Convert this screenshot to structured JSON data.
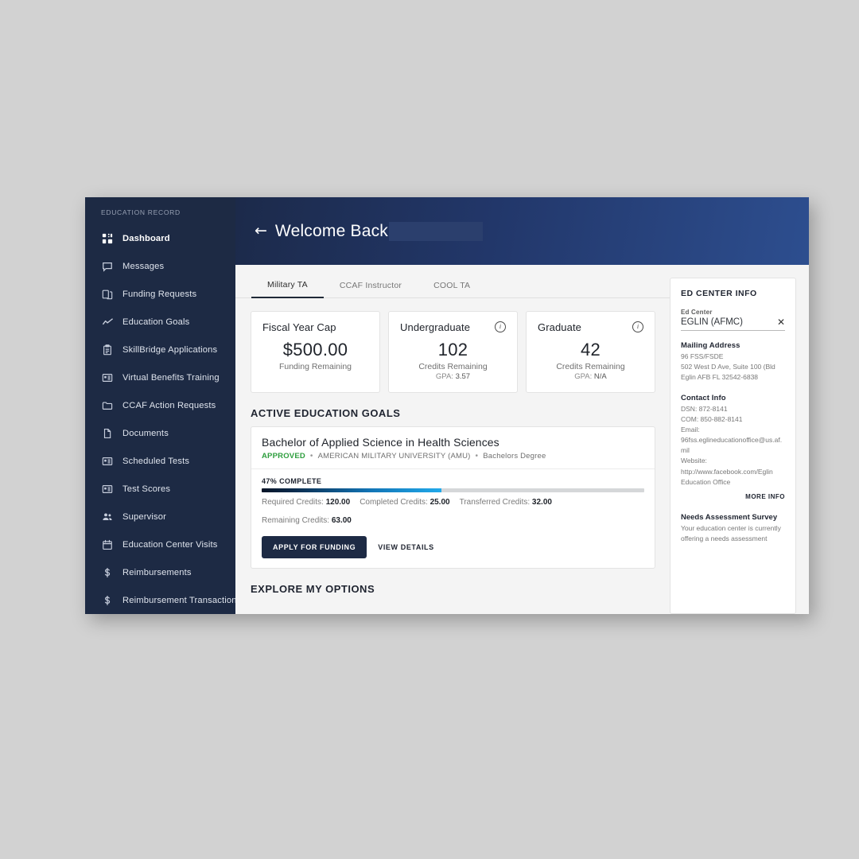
{
  "sidebar": {
    "title": "EDUCATION RECORD",
    "items": [
      {
        "label": "Dashboard",
        "icon": "grid-icon",
        "active": true
      },
      {
        "label": "Messages",
        "icon": "chat-bubble-icon",
        "active": false
      },
      {
        "label": "Funding Requests",
        "icon": "copy-documents-icon",
        "active": false
      },
      {
        "label": "Education Goals",
        "icon": "trend-line-icon",
        "active": false
      },
      {
        "label": "SkillBridge Applications",
        "icon": "clipboard-icon",
        "active": false
      },
      {
        "label": "Virtual Benefits Training",
        "icon": "id-card-icon",
        "active": false
      },
      {
        "label": "CCAF Action Requests",
        "icon": "folder-icon",
        "active": false
      },
      {
        "label": "Documents",
        "icon": "file-icon",
        "active": false
      },
      {
        "label": "Scheduled Tests",
        "icon": "id-card-icon",
        "active": false
      },
      {
        "label": "Test Scores",
        "icon": "id-card-icon",
        "active": false
      },
      {
        "label": "Supervisor",
        "icon": "people-icon",
        "active": false
      },
      {
        "label": "Education Center Visits",
        "icon": "calendar-icon",
        "active": false
      },
      {
        "label": "Reimbursements",
        "icon": "dollar-icon",
        "active": false
      },
      {
        "label": "Reimbursement Transactions",
        "icon": "dollar-icon",
        "active": false
      }
    ]
  },
  "header": {
    "back_arrow": "←",
    "title": "Welcome Back",
    "name_redacted": true
  },
  "tabs": [
    {
      "label": "Military TA",
      "active": true
    },
    {
      "label": "CCAF Instructor",
      "active": false
    },
    {
      "label": "COOL TA",
      "active": false
    }
  ],
  "stat_cards": [
    {
      "title": "Fiscal Year Cap",
      "value": "$500.00",
      "subtitle": "Funding Remaining",
      "gpa_label": "",
      "gpa_value": "",
      "has_info_icon": false
    },
    {
      "title": "Undergraduate",
      "value": "102",
      "subtitle": "Credits Remaining",
      "gpa_label": "GPA:",
      "gpa_value": "3.57",
      "has_info_icon": true
    },
    {
      "title": "Graduate",
      "value": "42",
      "subtitle": "Credits Remaining",
      "gpa_label": "GPA:",
      "gpa_value": "N/A",
      "has_info_icon": true
    }
  ],
  "goals_section": {
    "heading": "ACTIVE EDUCATION GOALS",
    "goal": {
      "name": "Bachelor of Applied Science in Health Sciences",
      "status": "APPROVED",
      "school": "AMERICAN MILITARY UNIVERSITY (AMU)",
      "degree": "Bachelors Degree",
      "progress_label": "47% COMPLETE",
      "progress_percent": 47,
      "credits": [
        {
          "label": "Required Credits:",
          "value": "120.00"
        },
        {
          "label": "Completed Credits:",
          "value": "25.00"
        },
        {
          "label": "Transferred Credits:",
          "value": "32.00"
        },
        {
          "label": "Remaining Credits:",
          "value": "63.00"
        }
      ],
      "primary_button": "APPLY FOR FUNDING",
      "link_button": "VIEW DETAILS"
    }
  },
  "explore_section": {
    "heading": "EXPLORE MY OPTIONS"
  },
  "ed_center_panel": {
    "title": "ED CENTER INFO",
    "field_label": "Ed Center",
    "selected_value": "EGLIN (AFMC)",
    "clear_icon": "✕",
    "mailing_address": {
      "heading": "Mailing Address",
      "lines": [
        "96 FSS/FSDE",
        "502 West D Ave, Suite 100 (Bld",
        "Eglin AFB FL 32542-6838"
      ]
    },
    "contact_info": {
      "heading": "Contact Info",
      "lines": [
        "DSN: 872-8141",
        "COM: 850-882-8141",
        "Email:",
        "96fss.eglineducationoffice@us.af.mil",
        "Website:",
        "http://www.facebook.com/Eglin",
        "Education Office"
      ]
    },
    "more_info_label": "MORE INFO",
    "survey": {
      "heading": "Needs Assessment Survey",
      "lines": [
        "Your education center is currently",
        "offering a needs assessment"
      ]
    }
  },
  "colors": {
    "sidebar_bg": "#1d2a44",
    "banner_left": "#1c2a4a",
    "banner_right": "#2d4e8f",
    "approved_green": "#2e9e3e",
    "progress_start": "#061427",
    "progress_end": "#21a9ea",
    "page_bg": "#f4f4f4"
  }
}
